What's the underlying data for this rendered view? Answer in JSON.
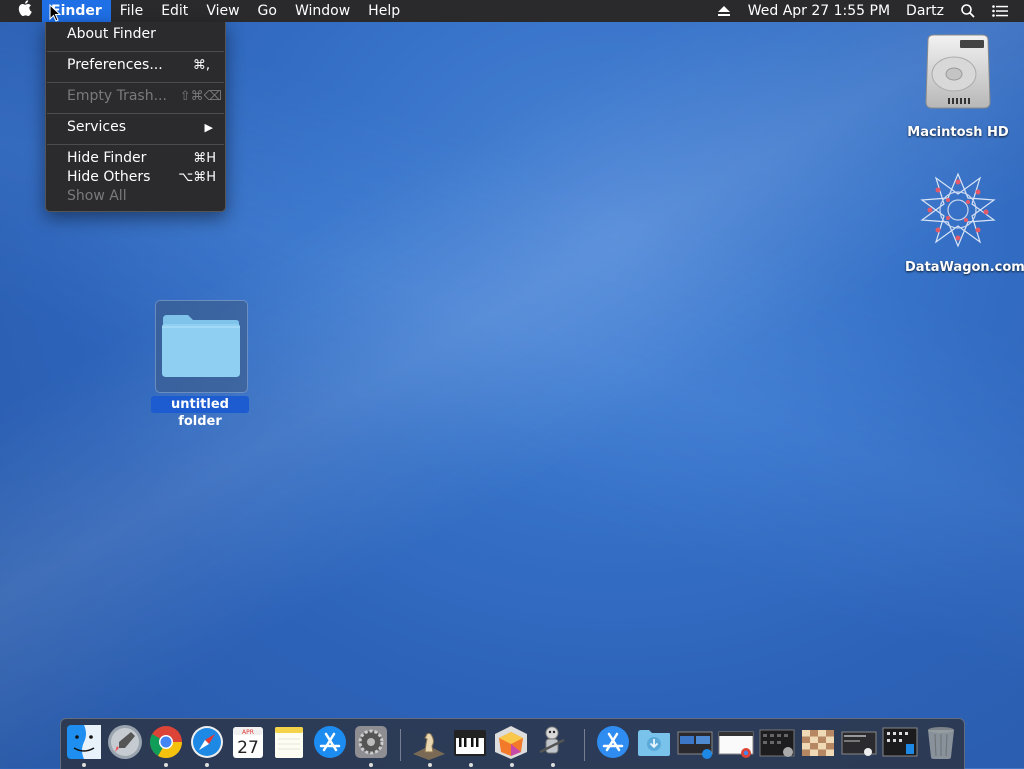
{
  "menubar": {
    "apple_icon": "apple-logo-icon",
    "items": [
      "Finder",
      "File",
      "Edit",
      "View",
      "Go",
      "Window",
      "Help"
    ],
    "active_index": 0,
    "status": {
      "eject_icon": "eject-icon",
      "datetime": "Wed Apr 27  1:55 PM",
      "user": "Dartz",
      "spotlight_icon": "search-icon",
      "notification_icon": "list-icon"
    }
  },
  "finder_menu": {
    "about": {
      "label": "About Finder",
      "shortcut": ""
    },
    "preferences": {
      "label": "Preferences...",
      "shortcut": "⌘,"
    },
    "empty_trash": {
      "label": "Empty Trash...",
      "shortcut": "⇧⌘⌫"
    },
    "services": {
      "label": "Services",
      "shortcut": "▶"
    },
    "hide_finder": {
      "label": "Hide Finder",
      "shortcut": "⌘H"
    },
    "hide_others": {
      "label": "Hide Others",
      "shortcut": "⌥⌘H"
    },
    "show_all": {
      "label": "Show All",
      "shortcut": ""
    }
  },
  "desktop": {
    "macintosh_hd": "Macintosh HD",
    "datawagon": "DataWagon.com",
    "folder": "untitled folder"
  },
  "dock": {
    "apps": [
      "finder-icon",
      "launchpad-icon",
      "chrome-icon",
      "safari-icon",
      "calendar-icon",
      "notes-icon",
      "app-store-icon",
      "system-preferences-icon",
      "chess-icon",
      "piano-icon",
      "grapher-icon",
      "automator-icon",
      "app-store-folder-icon",
      "downloads-folder-icon",
      "screenshot-stack-icon",
      "chrome-window-icon",
      "terminal-icon",
      "chess-board-icon",
      "web-window-icon",
      "mission-control-icon",
      "trash-icon"
    ],
    "calendar": {
      "month": "APR",
      "day": "27"
    }
  },
  "colors": {
    "menubar": "#2a2a2c",
    "accent": "#1f6fe6",
    "desktop": "#3672c8"
  }
}
